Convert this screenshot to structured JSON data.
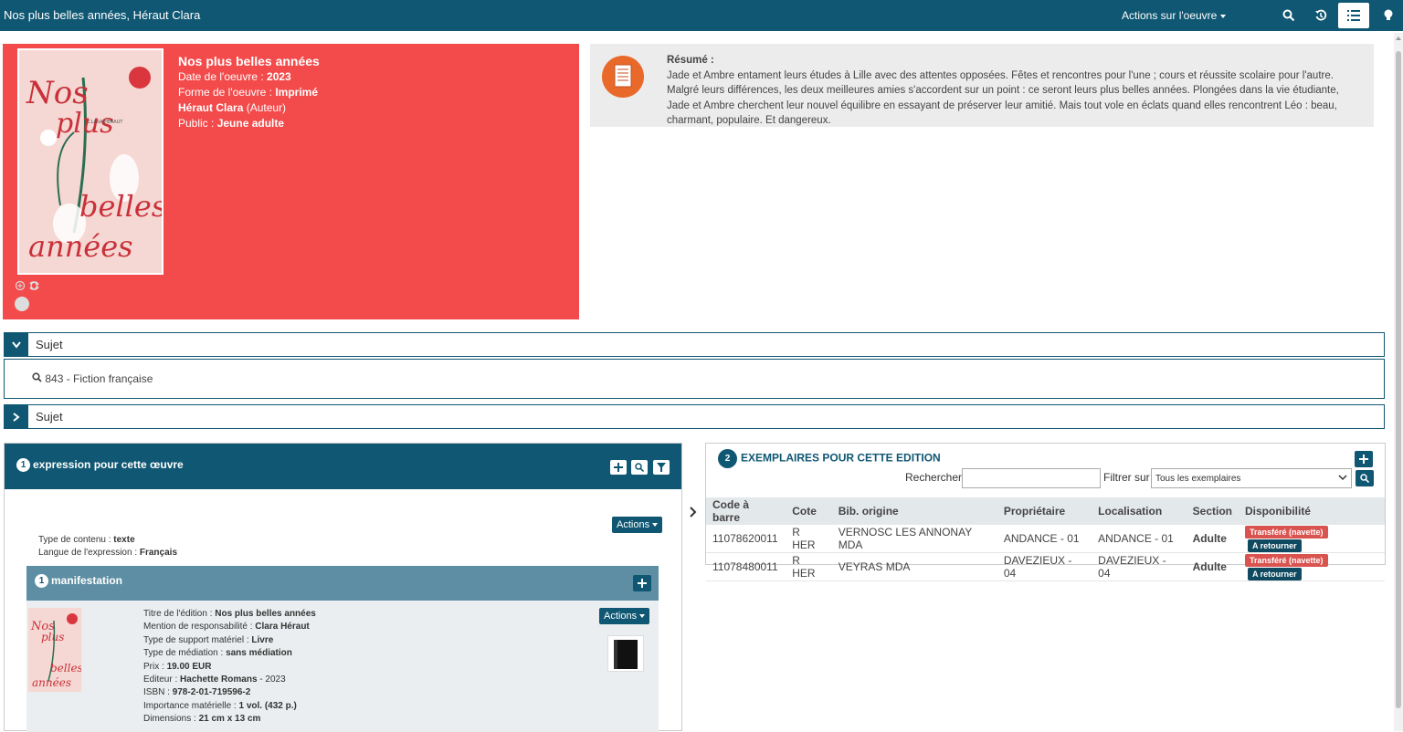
{
  "topbar": {
    "title": "Nos plus belles années, Héraut Clara",
    "actions_label": "Actions sur l'oeuvre",
    "icons": [
      "search-icon",
      "history-icon",
      "list-icon",
      "lightbulb-icon"
    ]
  },
  "hero": {
    "title": "Nos plus belles années",
    "date_label": "Date de l'oeuvre : ",
    "date_value": "2023",
    "forme_label": "Forme de l'oeuvre : ",
    "forme_value": "Imprimé",
    "author_name": "Héraut Clara",
    "author_role": " (Auteur)",
    "public_label": "Public : ",
    "public_value": "Jeune adulte",
    "cover_text_1": "Nos",
    "cover_text_2": "plus",
    "cover_text_3": "belles",
    "cover_text_4": "années",
    "cover_author": "CLARA HÉRAUT"
  },
  "resume": {
    "label": "Résumé :",
    "text": "Jade et Ambre entament leurs études à Lille avec des attentes opposées. Fêtes et rencontres pour l'une ; cours et réussite scolaire pour l'autre. Malgré leurs différences, les deux meilleures amies s'accordent sur un point : ce seront leurs plus belles années. Plongées dans la vie étudiante, Jade et Ambre cherchent leur nouvel équilibre en essayant de préserver leur amitié. Mais tout vole en éclats quand elles rencontrent Léo : beau, charmant, populaire. Et dangereux."
  },
  "sujet": {
    "label_1": "Sujet",
    "item": "843 - Fiction française",
    "label_2": "Sujet"
  },
  "expression": {
    "count": "1",
    "title": "expression pour cette œuvre",
    "actions_label": "Actions",
    "type_label": "Type de contenu : ",
    "type_value": "texte",
    "langue_label": "Langue de l'expression : ",
    "langue_value": "Français"
  },
  "manifestation": {
    "count": "1",
    "title": "manifestation",
    "actions_label": "Actions",
    "fields": [
      {
        "label": "Titre de l'édition : ",
        "value": "Nos plus belles années",
        "extra": ""
      },
      {
        "label": "Mention de responsabilité : ",
        "value": "Clara Héraut",
        "extra": ""
      },
      {
        "label": "Type de support matériel : ",
        "value": "Livre",
        "extra": ""
      },
      {
        "label": "Type de médiation : ",
        "value": "sans médiation",
        "extra": ""
      },
      {
        "label": "Prix : ",
        "value": "19.00 EUR",
        "extra": ""
      },
      {
        "label": "Editeur : ",
        "value": "Hachette Romans",
        "extra": " - 2023"
      },
      {
        "label": "ISBN : ",
        "value": "978-2-01-719596-2",
        "extra": ""
      },
      {
        "label": "Importance matérielle : ",
        "value": "1 vol. (432 p.)",
        "extra": ""
      },
      {
        "label": "Dimensions : ",
        "value": "21 cm x 13 cm",
        "extra": ""
      }
    ]
  },
  "exemplaires": {
    "count": "2",
    "title": "EXEMPLAIRES POUR CETTE EDITION",
    "search_label": "Rechercher",
    "search_value": "",
    "filter_label": "Filtrer sur",
    "filter_value": "Tous les exemplaires",
    "columns": [
      "Code à barre",
      "Cote",
      "Bib. origine",
      "Propriétaire",
      "Localisation",
      "Section",
      "Disponibilité"
    ],
    "rows": [
      {
        "code": "11078620011",
        "cote": "R HER",
        "bib": "VERNOSC LES ANNONAY MDA",
        "prop": "ANDANCE - 01",
        "loc": "ANDANCE - 01",
        "section": "Adulte",
        "status1": "Transféré (navette)",
        "status2": "A retourner"
      },
      {
        "code": "11078480011",
        "cote": "R HER",
        "bib": "VEYRAS MDA",
        "prop": "DAVEZIEUX - 04",
        "loc": "DAVEZIEUX - 04",
        "section": "Adulte",
        "status1": "Transféré (navette)",
        "status2": "A retourner"
      }
    ]
  },
  "colors": {
    "brand": "#0f5772",
    "hero": "#f34b4b",
    "resume_bg": "#ececec",
    "manif_head": "#5e8ea3",
    "status_red": "#d9534f"
  }
}
